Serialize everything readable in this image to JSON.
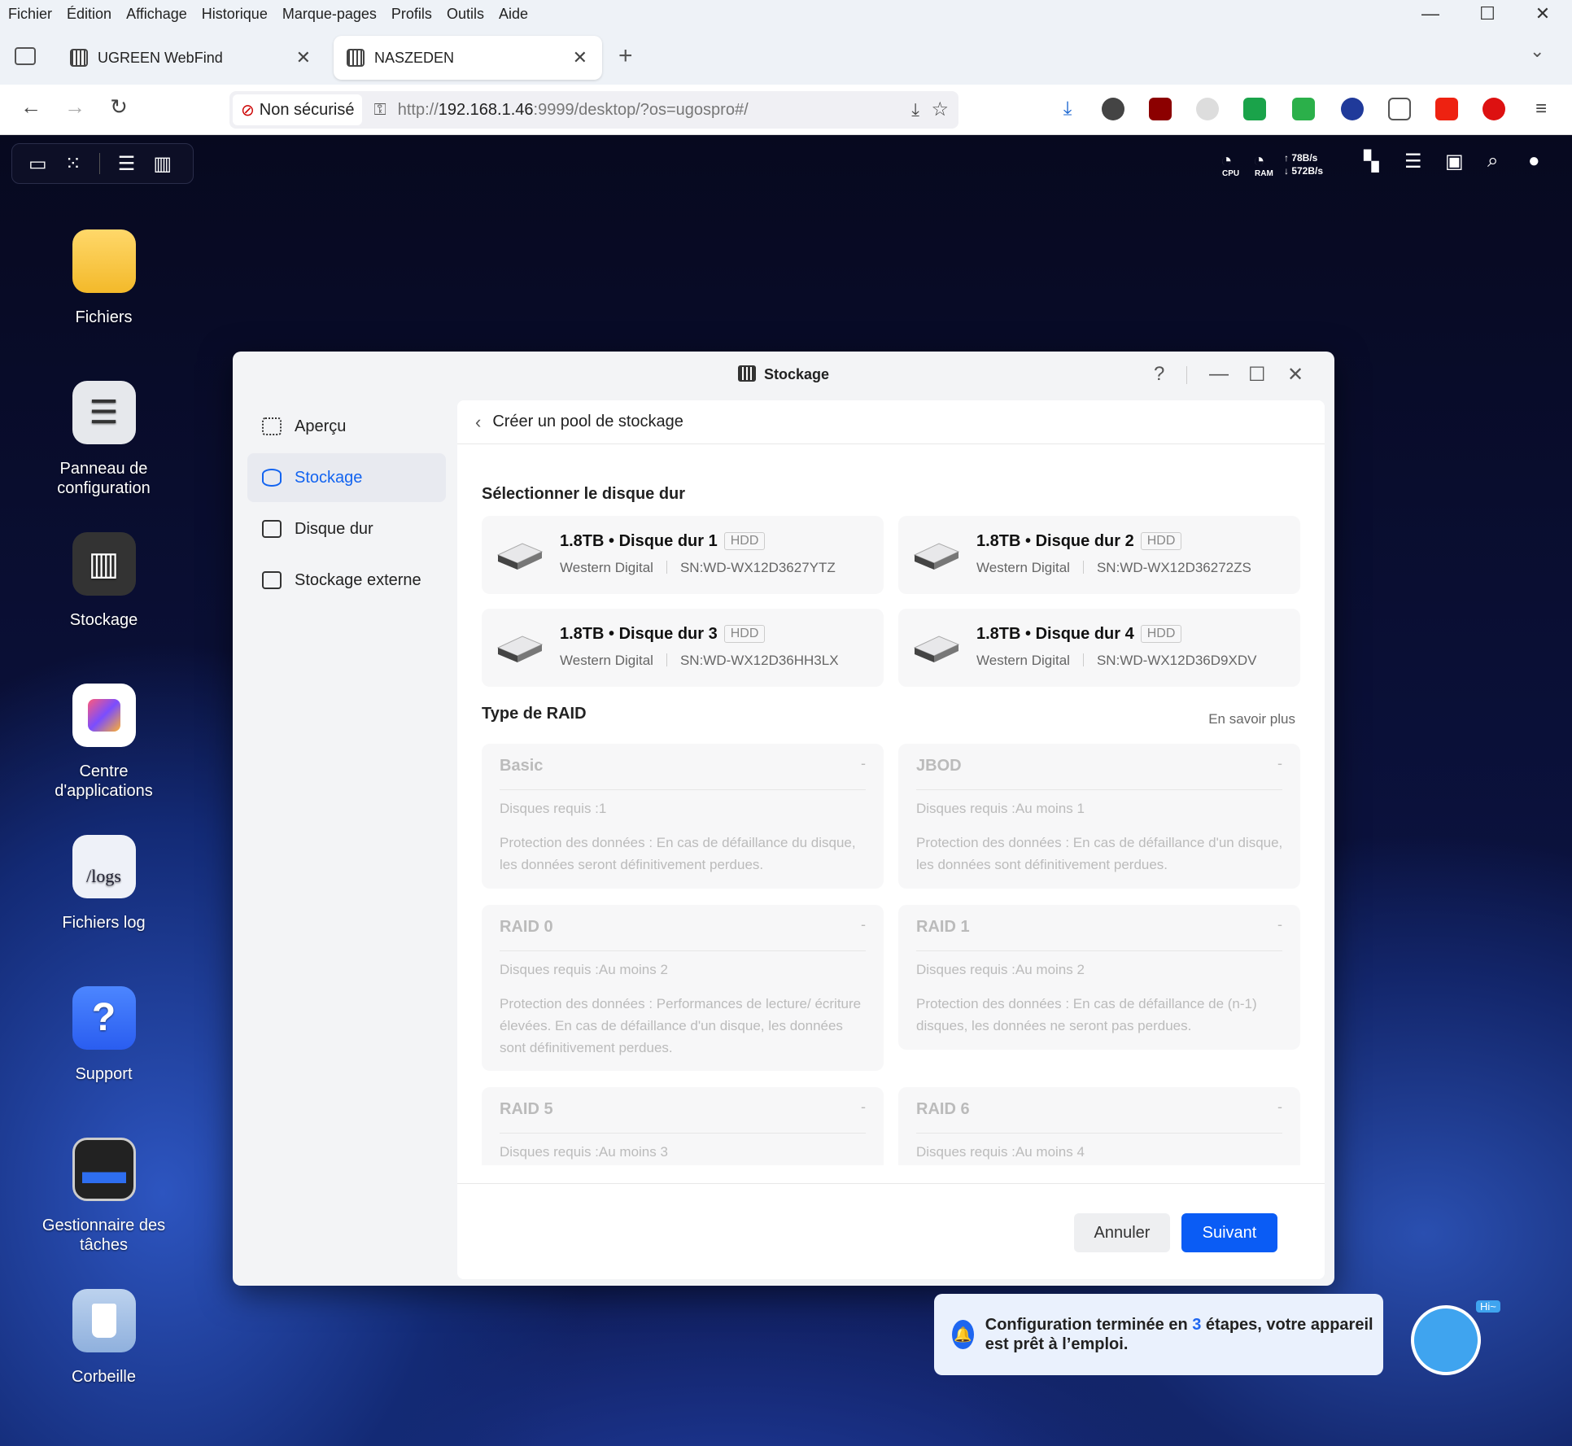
{
  "browser": {
    "menu": [
      "Fichier",
      "Édition",
      "Affichage",
      "Historique",
      "Marque-pages",
      "Profils",
      "Outils",
      "Aide"
    ],
    "tabs": [
      {
        "title": "UGREEN WebFind"
      },
      {
        "title": "NASZEDEN"
      }
    ],
    "security": "Non sécurisé",
    "url_prefix": "http://",
    "url_host": "192.168.1.46",
    "url_rest": ":9999/desktop/?os=ugospro#/",
    "window_controls": {
      "minimize": "—",
      "maximize": "☐",
      "close": "✕"
    }
  },
  "topbar": {
    "cpu": "CPU",
    "ram": "RAM",
    "up": "↑ 78B/s",
    "down": "↓ 572B/s"
  },
  "desktop_icons": [
    {
      "label": "Fichiers",
      "icon": "folder-icon"
    },
    {
      "label": "Panneau de configuration",
      "icon": "settings-sliders-icon"
    },
    {
      "label": "Stockage",
      "icon": "storage-icon"
    },
    {
      "label": "Centre d'applications",
      "icon": "app-center-icon"
    },
    {
      "label": "Fichiers log",
      "icon": "logs-icon",
      "icon_text": "/logs"
    },
    {
      "label": "Support",
      "icon": "help-icon",
      "icon_text": "?"
    },
    {
      "label": "Gestionnaire des tâches",
      "icon": "task-manager-icon"
    },
    {
      "label": "Corbeille",
      "icon": "trash-icon"
    }
  ],
  "window": {
    "title": "Stockage",
    "help": "?",
    "sidebar": [
      {
        "label": "Aperçu",
        "icon": "overview-icon"
      },
      {
        "label": "Stockage",
        "icon": "database-icon",
        "active": true
      },
      {
        "label": "Disque dur",
        "icon": "hard-drive-icon"
      },
      {
        "label": "Stockage externe",
        "icon": "external-storage-icon"
      }
    ],
    "header": "Créer un pool de stockage",
    "select_disk_title": "Sélectionner le disque dur",
    "disks": [
      {
        "size": "1.8TB",
        "name": "Disque dur 1",
        "type": "HDD",
        "vendor": "Western Digital",
        "sn": "SN:WD-WX12D3627YTZ"
      },
      {
        "size": "1.8TB",
        "name": "Disque dur 2",
        "type": "HDD",
        "vendor": "Western Digital",
        "sn": "SN:WD-WX12D36272ZS"
      },
      {
        "size": "1.8TB",
        "name": "Disque dur 3",
        "type": "HDD",
        "vendor": "Western Digital",
        "sn": "SN:WD-WX12D36HH3LX"
      },
      {
        "size": "1.8TB",
        "name": "Disque dur 4",
        "type": "HDD",
        "vendor": "Western Digital",
        "sn": "SN:WD-WX12D36D9XDV"
      }
    ],
    "raid_title": "Type de RAID",
    "learn_more": "En savoir plus",
    "raids": [
      {
        "name": "Basic",
        "dash": "-",
        "req": "Disques requis :1",
        "prot": "Protection des données : En cas de défaillance du disque, les données seront définitivement perdues."
      },
      {
        "name": "JBOD",
        "dash": "-",
        "req": "Disques requis :Au moins 1",
        "prot": "Protection des données : En cas de défaillance d'un disque, les données sont définitivement perdues."
      },
      {
        "name": "RAID 0",
        "dash": "-",
        "req": "Disques requis :Au moins 2",
        "prot": "Protection des données : Performances de lecture/ écriture élevées. En cas de défaillance d'un disque, les données sont définitivement perdues."
      },
      {
        "name": "RAID 1",
        "dash": "-",
        "req": "Disques requis :Au moins 2",
        "prot": "Protection des données : En cas de défaillance de (n-1) disques, les données ne seront pas perdues."
      },
      {
        "name": "RAID 5",
        "dash": "-",
        "req": "Disques requis :Au moins 3",
        "prot": ""
      },
      {
        "name": "RAID 6",
        "dash": "-",
        "req": "Disques requis :Au moins 4",
        "prot": ""
      }
    ],
    "cancel": "Annuler",
    "next": "Suivant"
  },
  "toast": {
    "before": "Configuration terminée en ",
    "count": "3",
    "after": " étapes, votre appareil est prêt à l’emploi."
  },
  "assistant": {
    "greeting": "Hi~"
  },
  "colors": {
    "accent": "#1364f0",
    "button": "#0a5cf5"
  }
}
